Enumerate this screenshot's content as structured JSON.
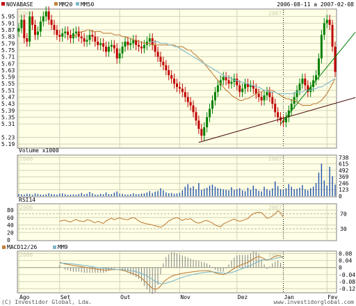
{
  "header": {
    "legend": [
      {
        "label": "NOVABASE",
        "color": "#c00000"
      },
      {
        "label": "MM20",
        "color": "#c0803a"
      },
      {
        "label": "MM50",
        "color": "#7fb8c8"
      }
    ],
    "range": "2006-08-11 a 2007-02-08"
  },
  "footer": {
    "left": "(C) Investidor Global, Lda.",
    "right": "www.investidorglobal.com"
  },
  "years": [
    "2006",
    "2007"
  ],
  "colors": {
    "panel_bg": "#ffffe6",
    "grid": "#d2d2b8",
    "up": "#008000",
    "down": "#c00000",
    "volume": "#2050b0",
    "rsi": "#c0803a",
    "macd": "#c0803a",
    "signal": "#7fb8c8",
    "hist": "#808080",
    "trend_support": "#400000",
    "trend_green": "#008000"
  },
  "chart_data": [
    {
      "type": "candlestick",
      "name": "NOVABASE",
      "x_tick_labels": [
        "Ago",
        "Set",
        "Out",
        "Nov",
        "Dez",
        "Jan",
        "Fev"
      ],
      "y_ticks": [
        5.19,
        5.23,
        5.31,
        5.35,
        5.39,
        5.43,
        5.47,
        5.51,
        5.55,
        5.59,
        5.63,
        5.67,
        5.71,
        5.75,
        5.79,
        5.83,
        5.87,
        5.91,
        5.95
      ],
      "ylim": [
        5.17,
        5.99
      ],
      "close": [
        5.88,
        5.93,
        5.82,
        5.8,
        5.95,
        5.9,
        5.84,
        5.86,
        5.92,
        5.95,
        5.98,
        5.93,
        5.9,
        5.87,
        5.84,
        5.83,
        5.85,
        5.86,
        5.84,
        5.82,
        5.85,
        5.86,
        5.83,
        5.82,
        5.8,
        5.81,
        5.84,
        5.83,
        5.8,
        5.78,
        5.79,
        5.77,
        5.74,
        5.77,
        5.78,
        5.76,
        5.7,
        5.73,
        5.77,
        5.8,
        5.78,
        5.79,
        5.81,
        5.78,
        5.77,
        5.76,
        5.78,
        5.8,
        5.82,
        5.78,
        5.74,
        5.71,
        5.68,
        5.66,
        5.63,
        5.6,
        5.58,
        5.55,
        5.53,
        5.52,
        5.5,
        5.47,
        5.44,
        5.42,
        5.38,
        5.33,
        5.28,
        5.24,
        5.29,
        5.35,
        5.4,
        5.45,
        5.5,
        5.54,
        5.57,
        5.59,
        5.57,
        5.55,
        5.56,
        5.58,
        5.54,
        5.5,
        5.52,
        5.55,
        5.53,
        5.54,
        5.52,
        5.49,
        5.47,
        5.45,
        5.48,
        5.5,
        5.47,
        5.43,
        5.38,
        5.35,
        5.33,
        5.32,
        5.35,
        5.39,
        5.43,
        5.47,
        5.51,
        5.55,
        5.58,
        5.54,
        5.5,
        5.53,
        5.57,
        5.6,
        5.7,
        5.84,
        5.91,
        5.93,
        5.9,
        5.77,
        5.62
      ],
      "ma20": [
        5.83,
        5.84,
        5.85,
        5.86,
        5.86,
        5.87,
        5.87,
        5.86,
        5.86,
        5.86,
        5.86,
        5.85,
        5.85,
        5.85,
        5.85,
        5.84,
        5.84,
        5.84,
        5.83,
        5.83,
        5.82,
        5.82,
        5.81,
        5.81,
        5.8,
        5.8,
        5.79,
        5.79,
        5.79,
        5.78,
        5.78,
        5.78,
        5.78,
        5.78,
        5.78,
        5.78,
        5.78,
        5.78,
        5.77,
        5.77,
        5.77,
        5.76,
        5.75,
        5.75,
        5.73,
        5.72,
        5.7,
        5.69,
        5.67,
        5.65,
        5.63,
        5.61,
        5.59,
        5.57,
        5.55,
        5.53,
        5.51,
        5.5,
        5.48,
        5.47,
        5.46,
        5.45,
        5.45,
        5.46,
        5.46,
        5.47,
        5.48,
        5.49,
        5.5,
        5.5,
        5.51,
        5.51,
        5.51,
        5.51,
        5.5,
        5.49,
        5.48,
        5.47,
        5.46,
        5.46,
        5.45,
        5.45,
        5.44,
        5.43,
        5.42,
        5.42,
        5.42,
        5.42,
        5.43,
        5.43,
        5.44,
        5.45,
        5.47,
        5.49,
        5.52,
        5.55,
        5.58
      ],
      "ma50": [
        5.8,
        5.8,
        5.8,
        5.8,
        5.79,
        5.79,
        5.79,
        5.78,
        5.78,
        5.77,
        5.77,
        5.76,
        5.75,
        5.74,
        5.73,
        5.72,
        5.71,
        5.7,
        5.69,
        5.68,
        5.67,
        5.66,
        5.65,
        5.64,
        5.63,
        5.62,
        5.61,
        5.6,
        5.59,
        5.59,
        5.58,
        5.57,
        5.57,
        5.56,
        5.56,
        5.55,
        5.55,
        5.54,
        5.54,
        5.53,
        5.53,
        5.52,
        5.51,
        5.51,
        5.5,
        5.5,
        5.5,
        5.49,
        5.49,
        5.49,
        5.49,
        5.49,
        5.49,
        5.49,
        5.5,
        5.5,
        5.5,
        5.51,
        5.51,
        5.51,
        5.52,
        5.52,
        5.53,
        5.53,
        5.54,
        5.55,
        5.56,
        5.57,
        5.58
      ],
      "trendline_1": {
        "from_index": 66,
        "from_value": 5.2,
        "to_index": 116,
        "to_value": 5.43
      },
      "trendline_2": {
        "from_index": 96,
        "from_value": 5.31,
        "to_index": 116,
        "to_value": 5.7
      }
    },
    {
      "type": "bar",
      "title": "Volume x1000",
      "y_ticks": [
        0,
        123,
        246,
        369,
        492,
        615,
        738
      ],
      "ylim": [
        0,
        770
      ],
      "values": [
        40,
        35,
        30,
        45,
        38,
        25,
        50,
        42,
        30,
        28,
        36,
        55,
        40,
        35,
        30,
        48,
        52,
        38,
        25,
        30,
        33,
        28,
        40,
        60,
        35,
        45,
        80,
        52,
        30,
        28,
        45,
        36,
        70,
        40,
        38,
        65,
        90,
        48,
        42,
        30,
        28,
        35,
        55,
        40,
        38,
        48,
        52,
        70,
        95,
        60,
        85,
        100,
        150,
        110,
        70,
        55,
        60,
        45,
        50,
        65,
        110,
        180,
        230,
        160,
        190,
        130,
        250,
        120,
        140,
        160,
        200,
        220,
        180,
        150,
        140,
        130,
        120,
        110,
        170,
        120,
        135,
        150,
        110,
        95,
        160,
        120,
        200,
        140,
        100,
        90,
        180,
        130,
        110,
        150,
        280,
        190,
        130,
        120,
        150,
        230,
        180,
        130,
        140,
        160,
        210,
        130,
        110,
        150,
        180,
        250,
        450,
        620,
        300,
        200,
        560,
        380,
        220
      ],
      "values_order": "per trading day"
    },
    {
      "type": "line",
      "title": "RSI14",
      "y_ticks": [
        0,
        20,
        40,
        60,
        80
      ],
      "right_ticks": [
        30,
        70
      ],
      "ylim": [
        0,
        95
      ],
      "start_index": 15,
      "values": [
        50,
        52,
        53,
        50,
        48,
        52,
        55,
        51,
        50,
        49,
        54,
        53,
        49,
        46,
        50,
        47,
        44,
        51,
        55,
        58,
        54,
        57,
        59,
        56,
        55,
        54,
        58,
        60,
        56,
        51,
        47,
        45,
        43,
        42,
        40,
        38,
        36,
        34,
        38,
        44,
        51,
        55,
        58,
        60,
        56,
        52,
        56,
        55,
        57,
        51,
        47,
        45,
        47,
        51,
        52,
        49,
        45,
        40,
        37,
        35,
        43,
        46,
        50,
        53,
        56,
        52,
        50,
        52,
        55,
        57,
        65,
        70,
        73,
        74,
        73,
        66,
        58,
        60,
        64,
        70,
        78,
        73,
        60
      ]
    },
    {
      "type": "line",
      "title": "MACD12/26",
      "series_names": [
        "MACD12/26",
        "MM9"
      ],
      "y_ticks": [
        0.08,
        0.04,
        0,
        -0.04,
        -0.08,
        -0.12
      ],
      "ylim": [
        -0.14,
        0.09
      ],
      "start_index": 15,
      "macd": [
        0.03,
        0.025,
        0.02,
        0.018,
        0.015,
        0.012,
        0.01,
        0.008,
        0.005,
        0.002,
        0.0,
        -0.003,
        -0.005,
        -0.008,
        -0.01,
        -0.012,
        -0.014,
        -0.015,
        -0.014,
        -0.013,
        -0.012,
        -0.011,
        -0.013,
        -0.016,
        -0.02,
        -0.025,
        -0.03,
        -0.035,
        -0.042,
        -0.05,
        -0.06,
        -0.075,
        -0.09,
        -0.105,
        -0.118,
        -0.125,
        -0.12,
        -0.105,
        -0.085,
        -0.07,
        -0.06,
        -0.05,
        -0.044,
        -0.04,
        -0.036,
        -0.033,
        -0.03,
        -0.028,
        -0.026,
        -0.024,
        -0.022,
        -0.02,
        -0.019,
        -0.018,
        -0.018,
        -0.02,
        -0.024,
        -0.03,
        -0.035,
        -0.038,
        -0.04,
        -0.035,
        -0.025,
        -0.015,
        -0.005,
        0.005,
        0.012,
        0.018,
        0.024,
        0.03,
        0.04,
        0.05,
        0.058,
        0.062,
        0.058,
        0.05,
        0.042,
        0.048,
        0.056,
        0.063,
        0.068,
        0.066,
        0.06
      ],
      "signal": [
        0.025,
        0.025,
        0.024,
        0.023,
        0.022,
        0.02,
        0.018,
        0.016,
        0.014,
        0.012,
        0.01,
        0.007,
        0.005,
        0.002,
        0.0,
        -0.002,
        -0.004,
        -0.006,
        -0.008,
        -0.009,
        -0.01,
        -0.011,
        -0.011,
        -0.012,
        -0.013,
        -0.015,
        -0.017,
        -0.02,
        -0.024,
        -0.028,
        -0.034,
        -0.04,
        -0.048,
        -0.058,
        -0.068,
        -0.078,
        -0.087,
        -0.092,
        -0.093,
        -0.09,
        -0.085,
        -0.079,
        -0.073,
        -0.067,
        -0.061,
        -0.056,
        -0.051,
        -0.047,
        -0.043,
        -0.039,
        -0.036,
        -0.033,
        -0.03,
        -0.028,
        -0.026,
        -0.025,
        -0.025,
        -0.026,
        -0.028,
        -0.03,
        -0.032,
        -0.033,
        -0.031,
        -0.028,
        -0.024,
        -0.018,
        -0.012,
        -0.006,
        0.0,
        0.006,
        0.013,
        0.02,
        0.028,
        0.036,
        0.042,
        0.044,
        0.045,
        0.046,
        0.048,
        0.052,
        0.055,
        0.057,
        0.058
      ]
    }
  ]
}
